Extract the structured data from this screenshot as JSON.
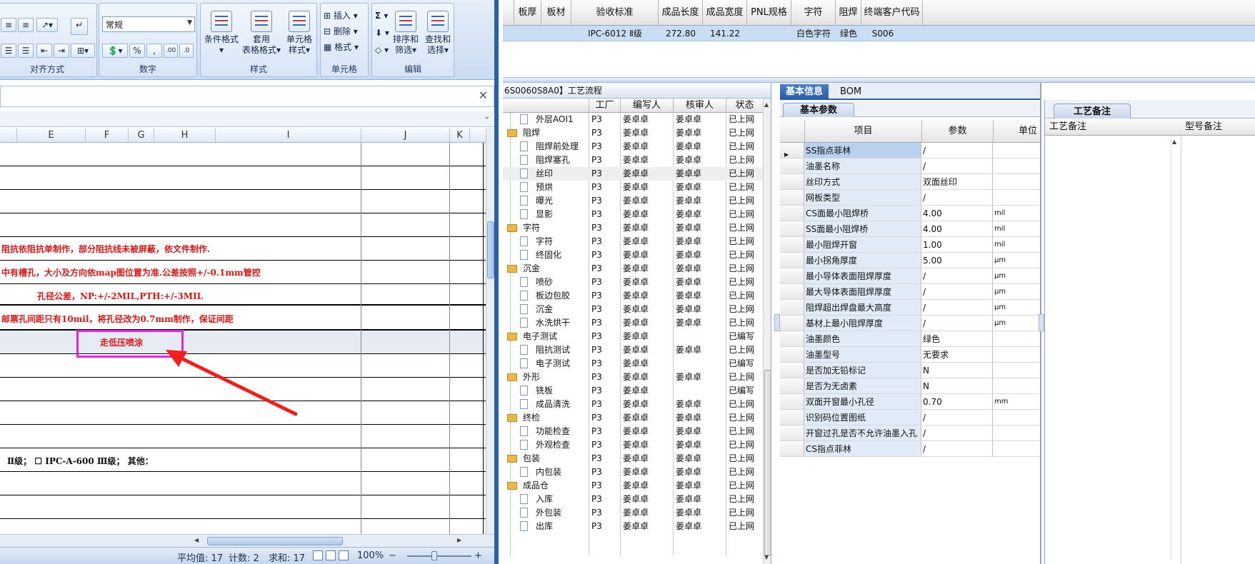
{
  "excel": {
    "ribbon": {
      "groups": {
        "alignment": "对齐方式",
        "number": "数字",
        "styles": "样式",
        "cells": "单元格",
        "editing": "编辑"
      },
      "number_format": "常规",
      "percent_btn": "%",
      "comma_btn": ",",
      "cond_format": "条件格式",
      "table_format_1": "套用",
      "table_format_2": "表格格式",
      "cell_style_1": "单元格",
      "cell_style_2": "样式",
      "insert": "插入",
      "delete": "删除",
      "format": "格式",
      "sort_1": "排序和",
      "sort_2": "筛选",
      "find_1": "查找和",
      "find_2": "选择",
      "sigma": "Σ"
    },
    "formula_close": "✕",
    "columns": [
      "E",
      "F",
      "G",
      "H",
      "I",
      "J",
      "K"
    ],
    "cells": {
      "r1": "阻抗依阻抗单制作，部分阻抗线未被屏蔽，依文件制作.",
      "r2": "中有槽孔，大小及方向依map图位置为准.公差按照+/-0.1mm管控",
      "r3": "孔径公差，NP:+/-2MIL,PTH:+/-3MIL",
      "r4": "邮票孔间距只有10mil，将孔径改为0.7mm制作，保证间距",
      "r5": "走低压喷涂",
      "r6": "Ⅱ级；  ☐ IPC-A-600 Ⅲ级；   其他："
    },
    "status": {
      "average": "平均值: 17",
      "count": "计数: 2",
      "sum": "求和: 17",
      "zoom": "100%",
      "zoom_out": "−",
      "zoom_in": "+"
    }
  },
  "erp": {
    "top_grid": {
      "headers": [
        "板厚",
        "板材",
        "验收标准",
        "成品长度",
        "成品宽度",
        "PNL规格",
        "字符",
        "阻焊",
        "终端客户代码"
      ],
      "row": {
        "standard": "IPC-6012 Ⅱ级",
        "length": "272.80",
        "width": "141.22",
        "char": "白色字符",
        "mask": "绿色",
        "customer": "S006"
      }
    },
    "process": {
      "title": "6S0060S8A0】工艺流程",
      "headers": {
        "factory": "工厂",
        "writer": "编写人",
        "reviewer": "核审人",
        "status": "状态"
      },
      "rows": [
        {
          "name": "外层AOI1",
          "folder": false,
          "factory": "P3",
          "writer": "姜卓卓",
          "reviewer": "姜卓卓",
          "status": "已上网"
        },
        {
          "name": "阻焊",
          "folder": true,
          "factory": "P3",
          "writer": "姜卓卓",
          "reviewer": "姜卓卓",
          "status": "已上网"
        },
        {
          "name": "阻焊前处理",
          "folder": false,
          "factory": "P3",
          "writer": "姜卓卓",
          "reviewer": "姜卓卓",
          "status": "已上网"
        },
        {
          "name": "阻焊塞孔",
          "folder": false,
          "factory": "P3",
          "writer": "姜卓卓",
          "reviewer": "姜卓卓",
          "status": "已上网"
        },
        {
          "name": "丝印",
          "folder": false,
          "factory": "P3",
          "writer": "姜卓卓",
          "reviewer": "姜卓卓",
          "status": "已上网",
          "selected": true
        },
        {
          "name": "预烘",
          "folder": false,
          "factory": "P3",
          "writer": "姜卓卓",
          "reviewer": "姜卓卓",
          "status": "已上网"
        },
        {
          "name": "曝光",
          "folder": false,
          "factory": "P3",
          "writer": "姜卓卓",
          "reviewer": "姜卓卓",
          "status": "已上网"
        },
        {
          "name": "显影",
          "folder": false,
          "factory": "P3",
          "writer": "姜卓卓",
          "reviewer": "姜卓卓",
          "status": "已上网"
        },
        {
          "name": "字符",
          "folder": true,
          "factory": "P3",
          "writer": "姜卓卓",
          "reviewer": "姜卓卓",
          "status": "已上网"
        },
        {
          "name": "字符",
          "folder": false,
          "factory": "P3",
          "writer": "姜卓卓",
          "reviewer": "姜卓卓",
          "status": "已上网"
        },
        {
          "name": "终固化",
          "folder": false,
          "factory": "P3",
          "writer": "姜卓卓",
          "reviewer": "姜卓卓",
          "status": "已上网"
        },
        {
          "name": "沉金",
          "folder": true,
          "factory": "P3",
          "writer": "姜卓卓",
          "reviewer": "姜卓卓",
          "status": "已上网"
        },
        {
          "name": "喷砂",
          "folder": false,
          "factory": "P3",
          "writer": "姜卓卓",
          "reviewer": "姜卓卓",
          "status": "已上网"
        },
        {
          "name": "板边包胶",
          "folder": false,
          "factory": "P3",
          "writer": "姜卓卓",
          "reviewer": "姜卓卓",
          "status": "已上网"
        },
        {
          "name": "沉金",
          "folder": false,
          "factory": "P3",
          "writer": "姜卓卓",
          "reviewer": "姜卓卓",
          "status": "已上网"
        },
        {
          "name": "水洗烘干",
          "folder": false,
          "factory": "P3",
          "writer": "姜卓卓",
          "reviewer": "姜卓卓",
          "status": "已上网"
        },
        {
          "name": "电子测试",
          "folder": true,
          "factory": "P3",
          "writer": "姜卓卓",
          "reviewer": "",
          "status": "已编写"
        },
        {
          "name": "阻抗测试",
          "folder": false,
          "factory": "P3",
          "writer": "姜卓卓",
          "reviewer": "姜卓卓",
          "status": "已上网"
        },
        {
          "name": "电子测试",
          "folder": false,
          "factory": "P3",
          "writer": "姜卓卓",
          "reviewer": "",
          "status": "已编写"
        },
        {
          "name": "外形",
          "folder": true,
          "factory": "P3",
          "writer": "姜卓卓",
          "reviewer": "姜卓卓",
          "status": "已上网"
        },
        {
          "name": "铣板",
          "folder": false,
          "factory": "P3",
          "writer": "姜卓卓",
          "reviewer": "",
          "status": "已编写"
        },
        {
          "name": "成品清洗",
          "folder": false,
          "factory": "P3",
          "writer": "姜卓卓",
          "reviewer": "姜卓卓",
          "status": "已上网"
        },
        {
          "name": "终检",
          "folder": true,
          "factory": "P3",
          "writer": "姜卓卓",
          "reviewer": "姜卓卓",
          "status": "已上网"
        },
        {
          "name": "功能检查",
          "folder": false,
          "factory": "P3",
          "writer": "姜卓卓",
          "reviewer": "姜卓卓",
          "status": "已上网"
        },
        {
          "name": "外观检查",
          "folder": false,
          "factory": "P3",
          "writer": "姜卓卓",
          "reviewer": "姜卓卓",
          "status": "已上网"
        },
        {
          "name": "包装",
          "folder": true,
          "factory": "P3",
          "writer": "姜卓卓",
          "reviewer": "姜卓卓",
          "status": "已上网"
        },
        {
          "name": "内包装",
          "folder": false,
          "factory": "P3",
          "writer": "姜卓卓",
          "reviewer": "姜卓卓",
          "status": "已上网"
        },
        {
          "name": "成品仓",
          "folder": true,
          "factory": "P3",
          "writer": "姜卓卓",
          "reviewer": "姜卓卓",
          "status": "已上网"
        },
        {
          "name": "入库",
          "folder": false,
          "factory": "P3",
          "writer": "姜卓卓",
          "reviewer": "姜卓卓",
          "status": "已上网"
        },
        {
          "name": "外包装",
          "folder": false,
          "factory": "P3",
          "writer": "姜卓卓",
          "reviewer": "姜卓卓",
          "status": "已上网"
        },
        {
          "name": "出库",
          "folder": false,
          "factory": "P3",
          "writer": "姜卓卓",
          "reviewer": "姜卓卓",
          "status": "已上网"
        }
      ]
    },
    "info": {
      "tabs": [
        "基本信息",
        "BOM"
      ],
      "subtab": "基本参数",
      "headers": {
        "item": "项目",
        "param": "参数",
        "unit": "单位"
      },
      "rows": [
        {
          "item": "SS指点菲林",
          "value": "/",
          "unit": "",
          "selected": true
        },
        {
          "item": "油墨名称",
          "value": "/",
          "unit": ""
        },
        {
          "item": "丝印方式",
          "value": "双面丝印",
          "unit": ""
        },
        {
          "item": "网板类型",
          "value": "/",
          "unit": ""
        },
        {
          "item": "CS面最小阻焊桥",
          "value": "4.00",
          "unit": "mil"
        },
        {
          "item": "SS面最小阻焊桥",
          "value": "4.00",
          "unit": "mil"
        },
        {
          "item": "最小阻焊开窗",
          "value": "1.00",
          "unit": "mil"
        },
        {
          "item": "最小拐角厚度",
          "value": "5.00",
          "unit": "μm"
        },
        {
          "item": "最小导体表面阻焊厚度",
          "value": "/",
          "unit": "μm"
        },
        {
          "item": "最大导体表面阻焊厚度",
          "value": "/",
          "unit": "μm"
        },
        {
          "item": "阻焊超出焊盘最大高度",
          "value": "/",
          "unit": "μm"
        },
        {
          "item": "基材上最小阻焊厚度",
          "value": "/",
          "unit": "μm"
        },
        {
          "item": "油墨颜色",
          "value": "绿色",
          "unit": ""
        },
        {
          "item": "油墨型号",
          "value": "无要求",
          "unit": ""
        },
        {
          "item": "是否加无铅标记",
          "value": "N",
          "unit": ""
        },
        {
          "item": "是否为无卤素",
          "value": "N",
          "unit": ""
        },
        {
          "item": "双面开窗最小孔径",
          "value": "0.70",
          "unit": "mm"
        },
        {
          "item": "识别码位置图纸",
          "value": "/",
          "unit": ""
        },
        {
          "item": "开窗过孔是否不允许油墨入孔",
          "value": "/",
          "unit": ""
        },
        {
          "item": "CS指点菲林",
          "value": "/",
          "unit": ""
        }
      ]
    },
    "remarks": {
      "tab": "工艺备注",
      "col1": "工艺备注",
      "col2": "型号备注"
    }
  }
}
